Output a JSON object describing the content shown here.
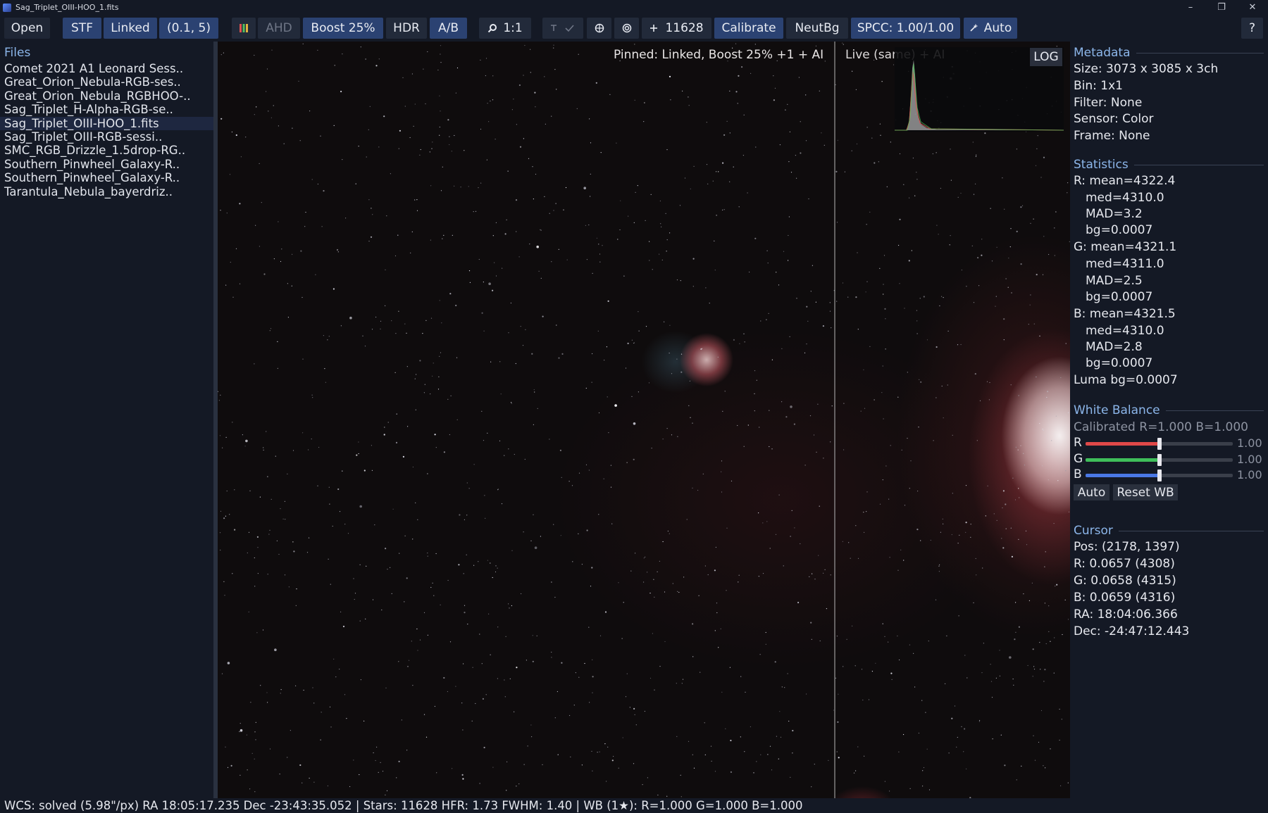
{
  "window": {
    "title": "Sag_Triplet_OIII-HOO_1.fits"
  },
  "toolbar": {
    "open": "Open",
    "stf": "STF",
    "linked": "Linked",
    "stretch_params": "(0.1, 5)",
    "ahd": "AHD",
    "boost": "Boost 25%",
    "hdr": "HDR",
    "ab": "A/B",
    "zoom": "1:1",
    "star_count": "11628",
    "calibrate": "Calibrate",
    "neutbg": "NeutBg",
    "spcc": "SPCC: 1.00/1.00",
    "auto": "Auto",
    "help": "?"
  },
  "files": {
    "header": "Files",
    "items": [
      "Comet 2021 A1 Leonard Sess..",
      "Great_Orion_Nebula-RGB-ses..",
      "Great_Orion_Nebula_RGBHOO-..",
      "Sag_Triplet_H-Alpha-RGB-se..",
      "Sag_Triplet_OIII-HOO_1.fits",
      "Sag_Triplet_OIII-RGB-sessi..",
      "SMC_RGB_Drizzle_1.5drop-RG..",
      "Southern_Pinwheel_Galaxy-R..",
      "Southern_Pinwheel_Galaxy-R..",
      "Tarantula_Nebula_bayerdriz.."
    ],
    "selected_index": 4
  },
  "viewer": {
    "pinned_label": "Pinned: Linked, Boost 25% +1 + AI",
    "live_label": "Live (same) + AI",
    "log_button": "LOG"
  },
  "metadata": {
    "title": "Metadata",
    "size": "Size: 3073 x 3085 x 3ch",
    "bin": "Bin: 1x1",
    "filter": "Filter: None",
    "sensor": "Sensor: Color",
    "frame": "Frame: None"
  },
  "statistics": {
    "title": "Statistics",
    "r_mean": "R: mean=4322.4",
    "r_med": "med=4310.0",
    "r_mad": "MAD=3.2",
    "r_bg": "bg=0.0007",
    "g_mean": "G: mean=4321.1",
    "g_med": "med=4311.0",
    "g_mad": "MAD=2.5",
    "g_bg": "bg=0.0007",
    "b_mean": "B: mean=4321.5",
    "b_med": "med=4310.0",
    "b_mad": "MAD=2.8",
    "b_bg": "bg=0.0007",
    "luma_bg": "Luma bg=0.0007"
  },
  "white_balance": {
    "title": "White Balance",
    "calibrated": "Calibrated R=1.000 B=1.000",
    "r_label": "R",
    "r_value": "1.00",
    "r_level": 0.5,
    "g_label": "G",
    "g_value": "1.00",
    "g_level": 0.5,
    "b_label": "B",
    "b_value": "1.00",
    "b_level": 0.5,
    "colors": {
      "r": "#e04848",
      "g": "#3fbf5a",
      "b": "#4a78e6"
    },
    "auto_button": "Auto",
    "reset_button": "Reset WB"
  },
  "cursor": {
    "title": "Cursor",
    "pos": "Pos: (2178, 1397)",
    "r": "R: 0.0657 (4308)",
    "g": "G: 0.0658 (4315)",
    "b": "B: 0.0659 (4316)",
    "ra": "RA: 18:04:06.366",
    "dec": "Dec: -24:47:12.443"
  },
  "status": {
    "text": "WCS: solved (5.98\"/px)  RA 18:05:17.235  Dec -23:43:35.052  |  Stars: 11628  HFR: 1.73  FWHM: 1.40  |  WB (1★): R=1.000 G=1.000 B=1.000"
  },
  "theme": {
    "accent": "#8cb6ea",
    "button_active": "#2b4272",
    "background": "#141925"
  }
}
